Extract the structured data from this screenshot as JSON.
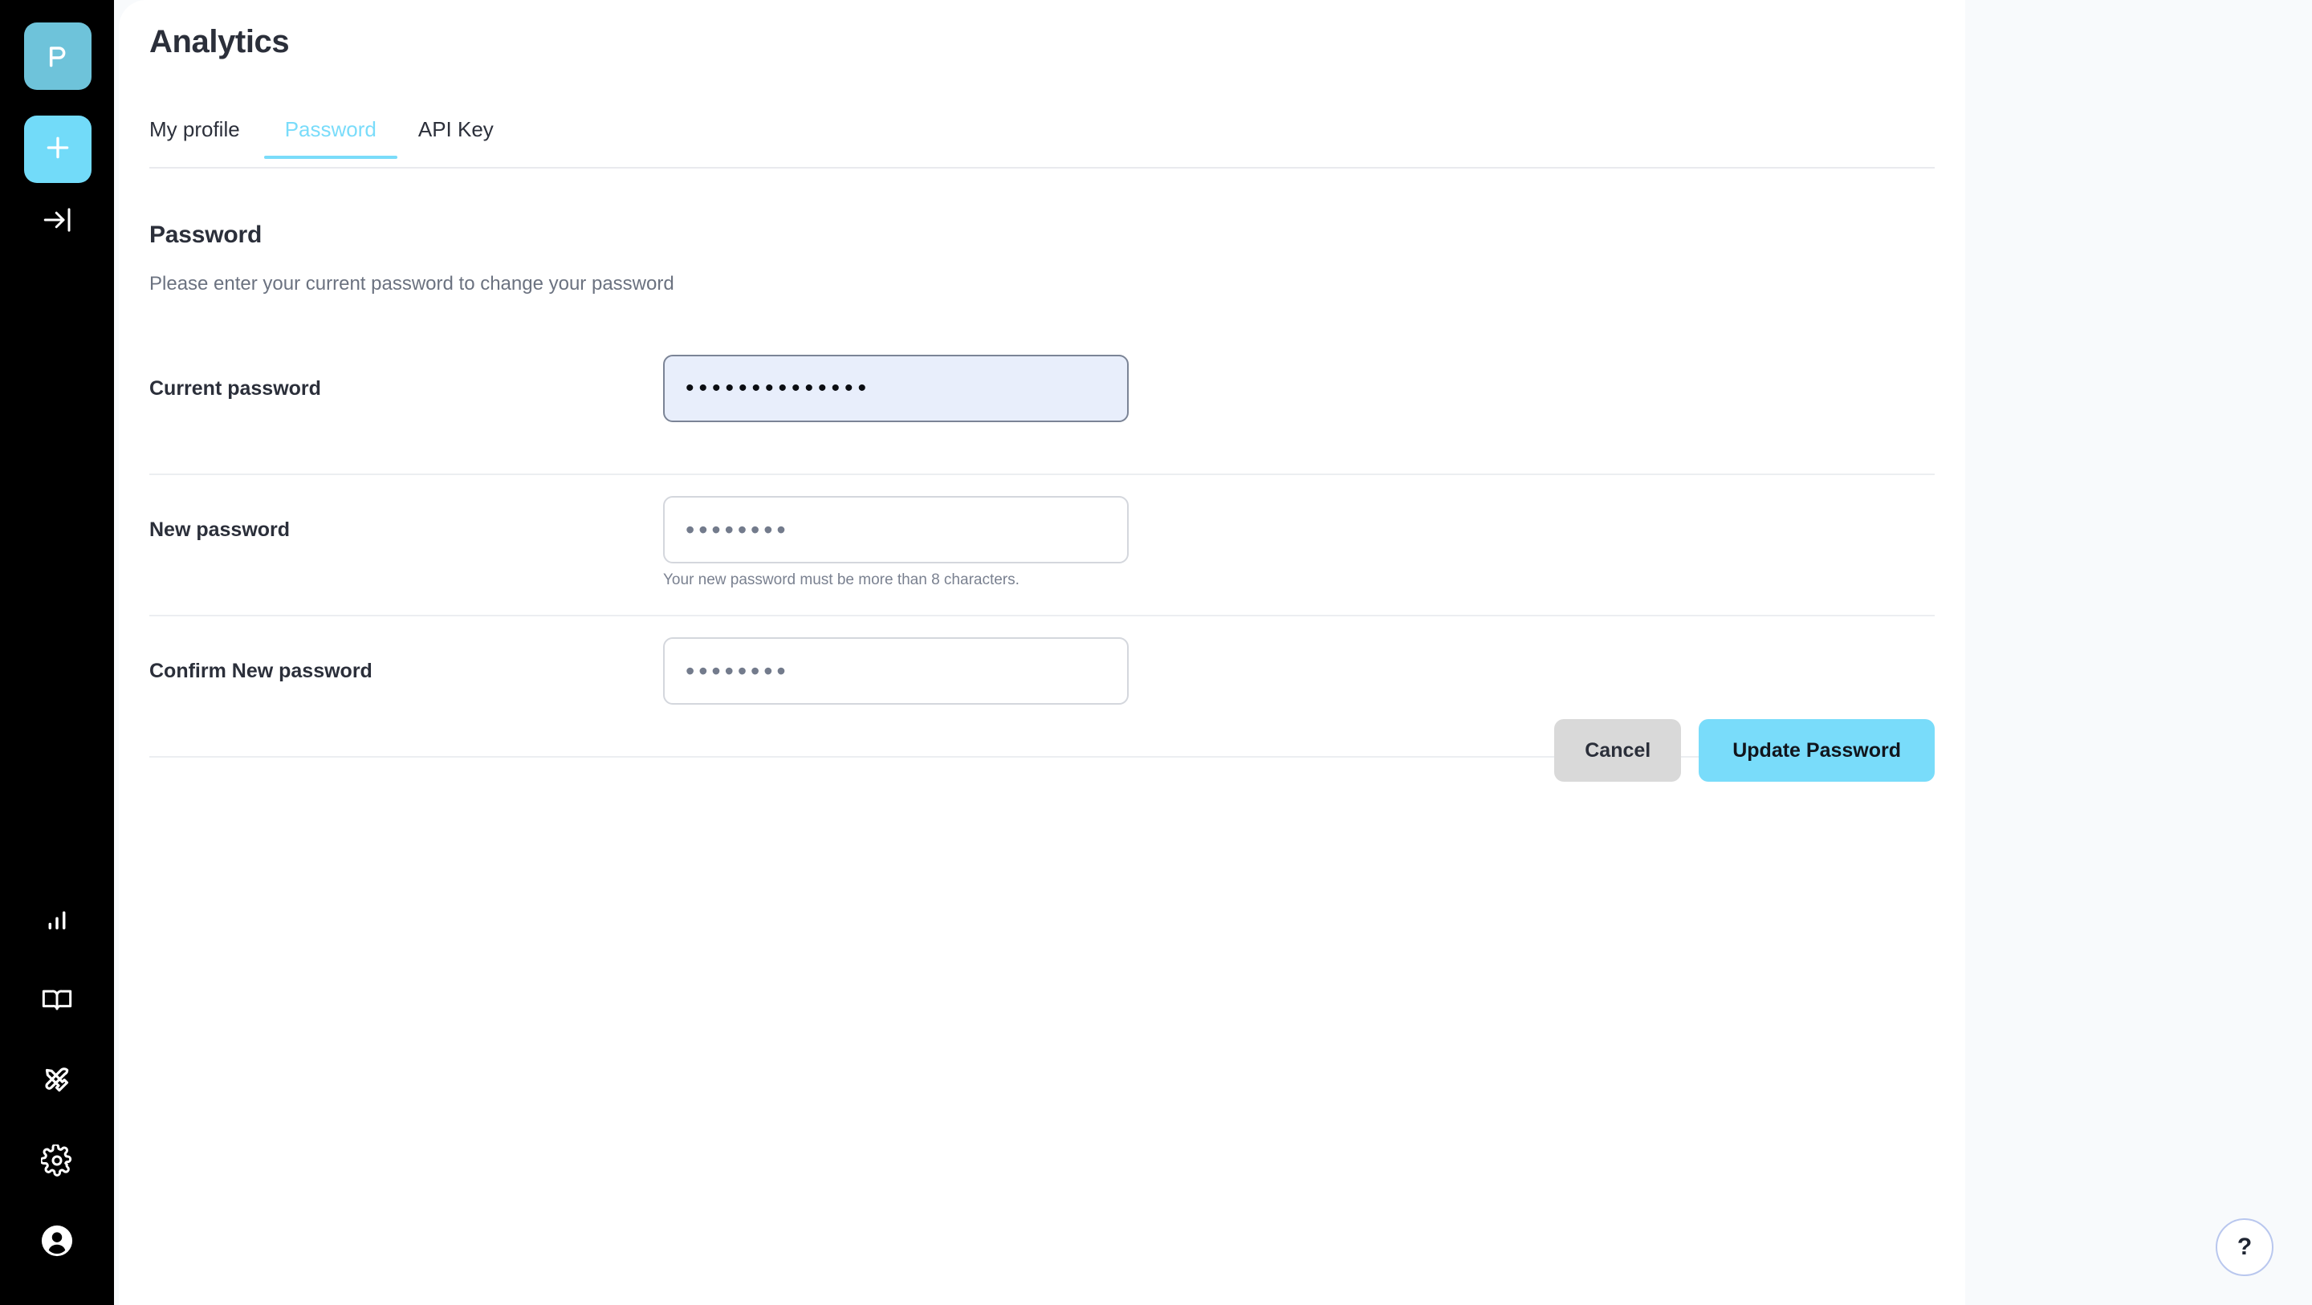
{
  "sidebar": {
    "logo": {
      "letter": "P",
      "icon": "logo-p-icon",
      "color": "#6ec3da"
    },
    "add_button": {
      "label": "+",
      "icon": "plus-icon",
      "color": "#72dbf9"
    },
    "collapse_button": {
      "icon": "collapse-right-arrow-icon"
    },
    "bottom_items": [
      {
        "icon": "bar-chart-icon",
        "name": "analytics"
      },
      {
        "icon": "book-icon",
        "name": "docs"
      },
      {
        "icon": "tools-icon",
        "name": "tools"
      },
      {
        "icon": "gear-icon",
        "name": "settings"
      },
      {
        "icon": "user-avatar-icon",
        "name": "profile"
      }
    ]
  },
  "header": {
    "title": "Analytics"
  },
  "tabs": [
    {
      "label": "My profile",
      "active": false
    },
    {
      "label": "Password",
      "active": true
    },
    {
      "label": "API Key",
      "active": false
    }
  ],
  "section": {
    "title": "Password",
    "description": "Please enter your current password to change your password"
  },
  "form": {
    "fields": [
      {
        "label": "Current password",
        "value": "••••••••••••••",
        "masked_char_count": 14,
        "focused": true,
        "hint": ""
      },
      {
        "label": "New password",
        "value": "••••••••",
        "masked_char_count": 8,
        "focused": false,
        "hint": "Your new password must be more than 8 characters."
      },
      {
        "label": "Confirm New password",
        "value": "••••••••",
        "masked_char_count": 8,
        "focused": false,
        "hint": ""
      }
    ]
  },
  "actions": {
    "cancel_label": "Cancel",
    "submit_label": "Update Password"
  },
  "help": {
    "label": "?",
    "icon": "question-mark-icon"
  },
  "colors": {
    "accent": "#7adcfa",
    "logo": "#6ec3da",
    "rail": "#000000",
    "page_background": "#f8fafc",
    "card_background": "#ffffff",
    "focused_field_background": "#e8eefb",
    "cancel_button": "#d9d9d9",
    "text_primary": "#2b2f3a",
    "text_muted": "#6b7280"
  }
}
